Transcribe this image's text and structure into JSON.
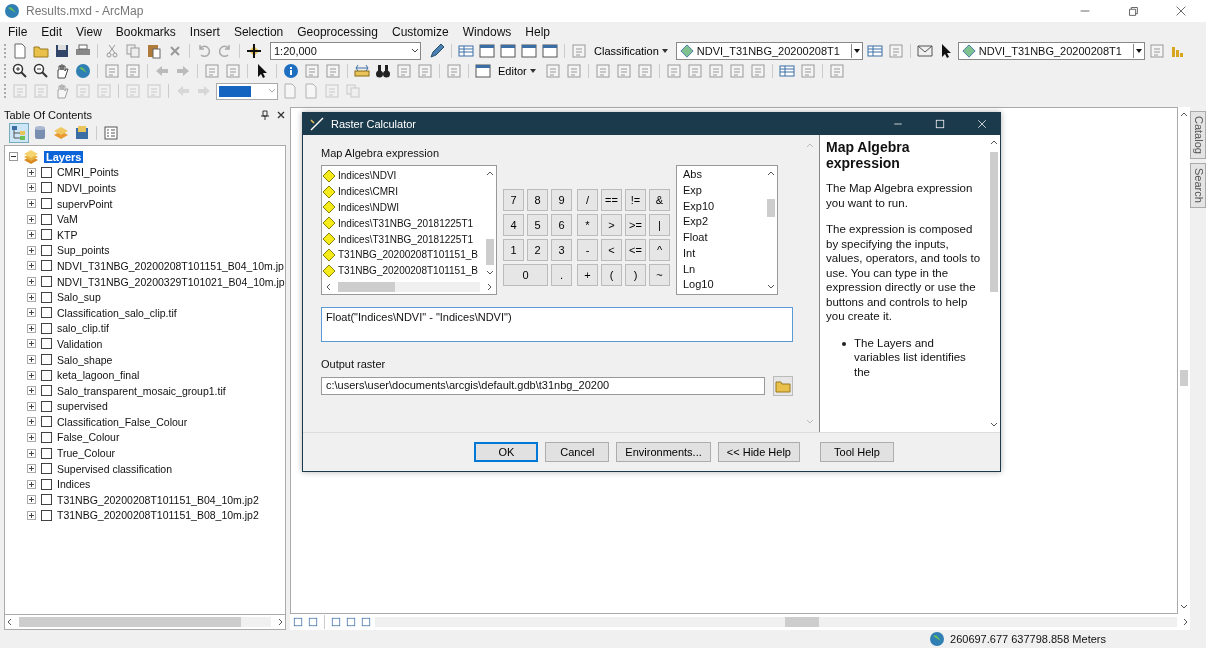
{
  "window": {
    "title": "Results.mxd - ArcMap"
  },
  "menu": [
    "File",
    "Edit",
    "View",
    "Bookmarks",
    "Insert",
    "Selection",
    "Geoprocessing",
    "Customize",
    "Windows",
    "Help"
  ],
  "toolbar": {
    "scale": "1:20,000",
    "classification": "Classification",
    "layer_combo_1": "NDVI_T31NBG_20200208T1",
    "layer_combo_2": "NDVI_T31NBG_20200208T1",
    "editor": "Editor"
  },
  "toc": {
    "title": "Table Of Contents",
    "root": {
      "label": "Layers",
      "expanded": true,
      "selected": true,
      "children": [
        {
          "label": "CMRI_Points",
          "checked": false,
          "expanded": false
        },
        {
          "label": "NDVI_points",
          "checked": false,
          "expanded": false
        },
        {
          "label": "supervPoint",
          "checked": false,
          "expanded": false
        },
        {
          "label": "VaM",
          "checked": false,
          "expanded": false
        },
        {
          "label": "KTP",
          "checked": false,
          "expanded": false
        },
        {
          "label": "Sup_points",
          "checked": false,
          "expanded": false
        },
        {
          "label": "NDVI_T31NBG_20200208T101151_B04_10m.jp",
          "checked": false,
          "expanded": false
        },
        {
          "label": "NDVI_T31NBG_20200329T101021_B04_10m.jp",
          "checked": false,
          "expanded": false
        },
        {
          "label": "Salo_sup",
          "checked": false,
          "expanded": false
        },
        {
          "label": "Classification_salo_clip.tif",
          "checked": false,
          "expanded": false
        },
        {
          "label": "salo_clip.tif",
          "checked": false,
          "expanded": false
        },
        {
          "label": "Validation",
          "checked": false,
          "expanded": false
        },
        {
          "label": "Salo_shape",
          "checked": false,
          "expanded": false
        },
        {
          "label": "keta_lagoon_final",
          "checked": false,
          "expanded": false
        },
        {
          "label": "Salo_transparent_mosaic_group1.tif",
          "checked": false,
          "expanded": false
        },
        {
          "label": "supervised",
          "checked": false,
          "expanded": false
        },
        {
          "label": "Classification_False_Colour",
          "checked": false,
          "expanded": false
        },
        {
          "label": "False_Colour",
          "checked": false,
          "expanded": false
        },
        {
          "label": "True_Colour",
          "checked": false,
          "expanded": false
        },
        {
          "label": "Supervised classification",
          "checked": false,
          "expanded": false
        },
        {
          "label": "Indices",
          "checked": false,
          "expanded": false
        },
        {
          "label": "T31NBG_20200208T101151_B04_10m.jp2",
          "checked": false,
          "expanded": false
        },
        {
          "label": "T31NBG_20200208T101151_B08_10m.jp2",
          "checked": false,
          "expanded": false
        }
      ]
    }
  },
  "dialog": {
    "title": "Raster Calculator",
    "expression_label": "Map Algebra expression",
    "layers": [
      "Indices\\NDVI",
      "Indices\\CMRI",
      "Indices\\NDWI",
      "Indices\\T31NBG_20181225T1",
      "Indices\\T31NBG_20181225T1",
      "T31NBG_20200208T101151_B",
      "T31NBG_20200208T101151_B"
    ],
    "digits": [
      {
        "label": "7",
        "kind": "normal"
      },
      {
        "label": "8",
        "kind": "normal"
      },
      {
        "label": "9",
        "kind": "normal"
      },
      {
        "label": "4",
        "kind": "normal"
      },
      {
        "label": "5",
        "kind": "normal"
      },
      {
        "label": "6",
        "kind": "normal"
      },
      {
        "label": "1",
        "kind": "normal"
      },
      {
        "label": "2",
        "kind": "normal"
      },
      {
        "label": "3",
        "kind": "normal"
      },
      {
        "label": "0",
        "kind": "wide"
      },
      {
        "label": ".",
        "kind": "normal"
      }
    ],
    "operators": [
      "/",
      "==",
      "!=",
      "&",
      "*",
      ">",
      ">=",
      "|",
      "-",
      "<",
      "<=",
      "^",
      "+",
      "(",
      ")",
      "~"
    ],
    "functions": [
      "Abs",
      "Exp",
      "Exp10",
      "Exp2",
      "Float",
      "Int",
      "Ln",
      "Log10"
    ],
    "expression": "Float(\"Indices\\NDVI\" - \"Indices\\NDVI\")",
    "output_label": "Output raster",
    "output_value": "c:\\users\\user\\documents\\arcgis\\default.gdb\\t31nbg_20200",
    "buttons": [
      "OK",
      "Cancel",
      "Environments...",
      "<< Hide Help"
    ],
    "help_button": "Tool Help",
    "help": {
      "title": "Map Algebra expression",
      "paragraphs": [
        "The Map Algebra expression you want to run.",
        "The expression is composed by specifying the inputs, values, operators, and tools to use. You can type in the expression directly or use the buttons and controls to help you create it."
      ],
      "bullets": [
        "The Layers and variables list identifies the"
      ]
    }
  },
  "side_tabs": [
    "Catalog",
    "Search"
  ],
  "status_bar": {
    "coordinates": "260697.677  637798.858 Meters"
  }
}
